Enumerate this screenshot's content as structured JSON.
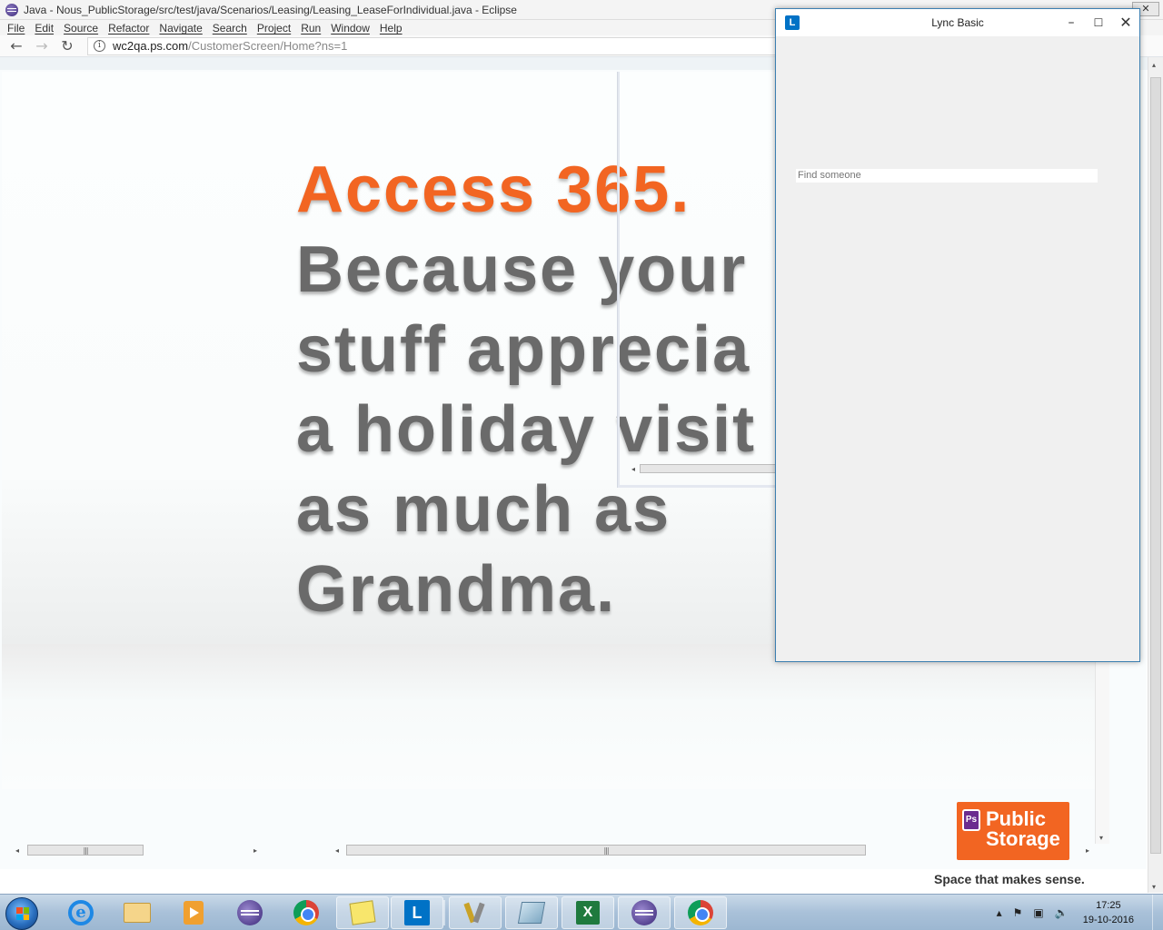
{
  "eclipse": {
    "title": "Java - Nous_PublicStorage/src/test/java/Scenarios/Leasing/Leasing_LeaseForIndividual.java - Eclipse",
    "close_glyph": "✕",
    "menu": [
      "File",
      "Edit",
      "Source",
      "Refactor",
      "Navigate",
      "Search",
      "Project",
      "Run",
      "Window",
      "Help"
    ]
  },
  "browser": {
    "back_glyph": "←",
    "forward_glyph": "→",
    "reload_glyph": "↻",
    "info_glyph": "i",
    "url_host": "wc2qa.ps.com",
    "url_path": "/CustomerScreen/Home?ns=1"
  },
  "hero": {
    "line1": "Access 365.",
    "line2": "Because your",
    "line3": "stuff apprecia",
    "line4": "a holiday visit",
    "line5": "as much as",
    "line6": "Grandma."
  },
  "scrollbars": {
    "left_glyph": "◂",
    "right_glyph": "▸",
    "up_glyph": "▴",
    "down_glyph": "▾",
    "grip": "|||"
  },
  "brand": {
    "badge": "Ps",
    "word1": "Public",
    "word2": "Storage",
    "tagline": "Space that makes sense.",
    "accent": "#f26522",
    "purple": "#6b2c8f"
  },
  "lync": {
    "logo": "L",
    "title": "Lync Basic",
    "min_glyph": "–",
    "max_glyph": "☐",
    "close_glyph": "✕",
    "search_placeholder": "Find someone",
    "accent": "#0072c6"
  },
  "taskbar": {
    "ie_glyph": "e",
    "lync_glyph": "L",
    "excel_glyph": "X",
    "tray_up": "▴",
    "tray_flag": "⚑",
    "tray_net": "▣",
    "tray_volume": "🔈",
    "time": "17:25",
    "date": "19-10-2016"
  }
}
